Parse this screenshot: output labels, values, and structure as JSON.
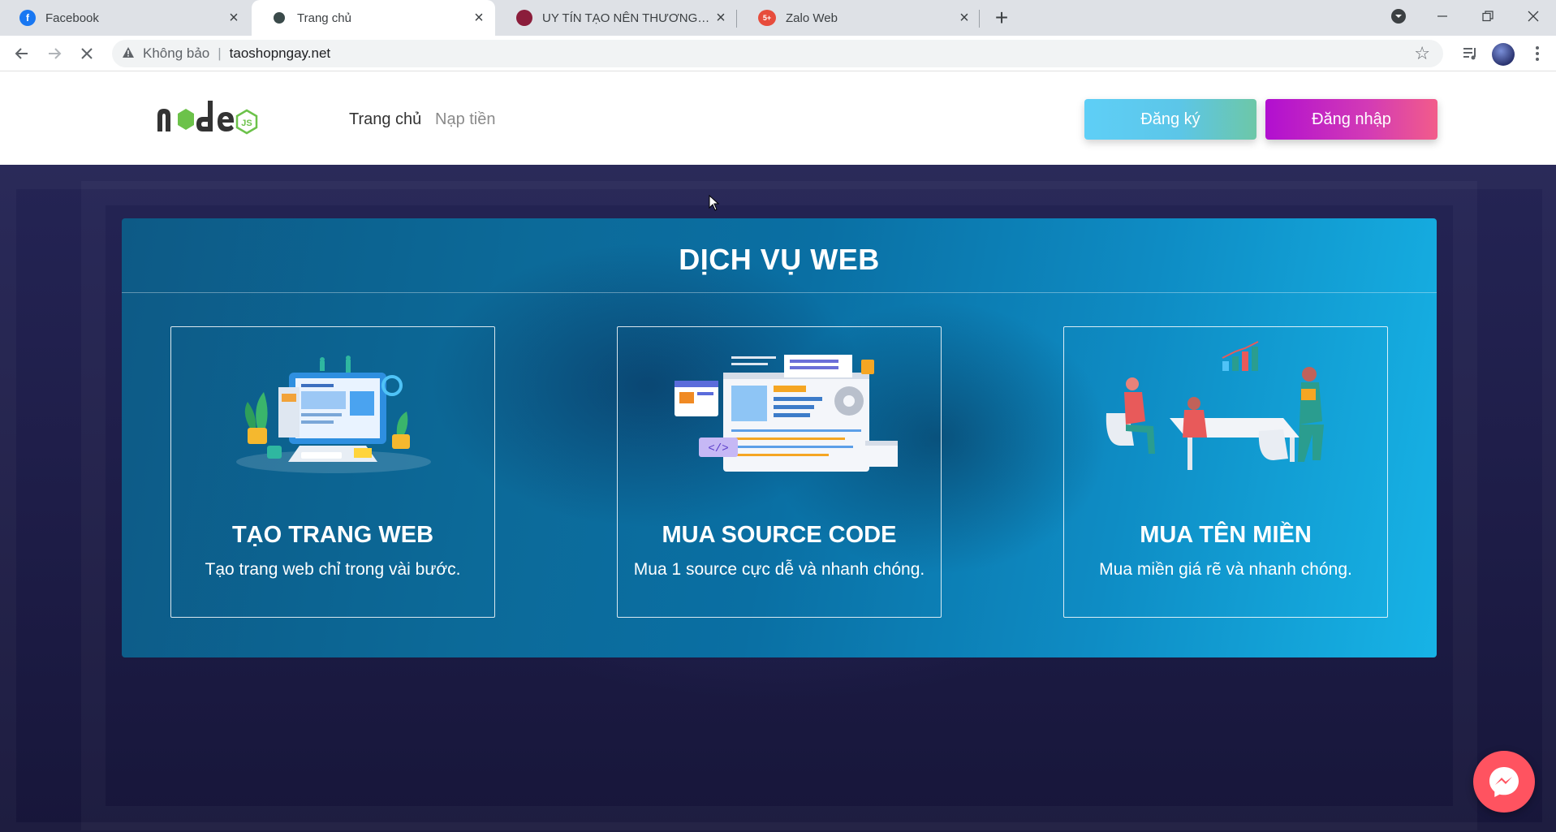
{
  "browser": {
    "tabs": [
      {
        "label": "Facebook",
        "icon": "facebook-icon"
      },
      {
        "label": "Trang chủ",
        "icon": "site-favicon"
      },
      {
        "label": "UY TÍN TẠO NÊN THƯƠNG HIỆU",
        "icon": "avatar-favicon"
      },
      {
        "label": "Zalo Web",
        "icon": "zalo-favicon",
        "badge": "5+"
      }
    ],
    "address": {
      "security_label": "Không bảo",
      "separator": "|",
      "url": "taoshopngay.net"
    }
  },
  "header": {
    "nav": {
      "home": "Trang chủ",
      "top_up": "Nạp tiền"
    },
    "signup_label": "Đăng ký",
    "login_label": "Đăng nhập"
  },
  "services": {
    "title": "DỊCH VỤ WEB",
    "cards": [
      {
        "title": "TẠO TRANG WEB",
        "desc": "Tạo trang web chỉ trong vài bước."
      },
      {
        "title": "MUA SOURCE CODE",
        "desc": "Mua 1 source cực dễ và nhanh chóng."
      },
      {
        "title": "MUA TÊN MIỀN",
        "desc": "Mua miền giá rẽ và nhanh chóng."
      }
    ]
  },
  "colors": {
    "signup_gradient": [
      "#5ecff7",
      "#6dc7a7"
    ],
    "login_gradient": [
      "#b10fd0",
      "#f25c8a"
    ],
    "services_gradient": [
      "#0d5a86",
      "#17b3e6"
    ],
    "page_bg": "#1e1d48",
    "messenger": "#ff5360"
  }
}
